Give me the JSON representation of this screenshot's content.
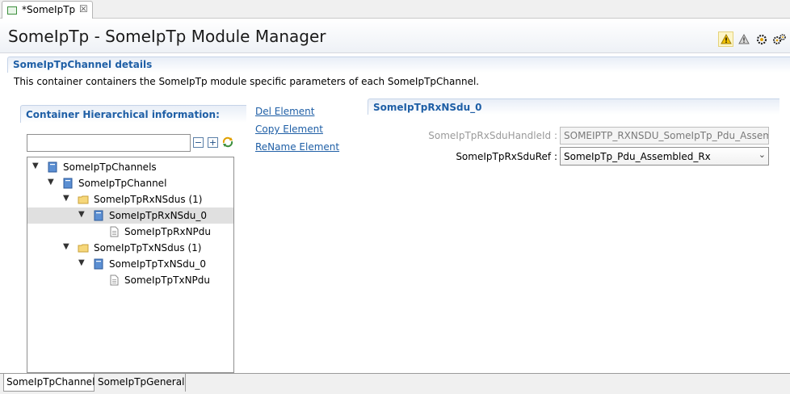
{
  "editor_tab": {
    "title": "*SomeIpTp",
    "close": "☒"
  },
  "header": {
    "title": "SomeIpTp - SomeIpTp Module Manager"
  },
  "section": {
    "title": "SomeIpTpChannel details",
    "description": "This container containers the SomeIpTp module specific parameters of each SomeIpTpChannel."
  },
  "hierarchy": {
    "title": "Container Hierarchical information:",
    "filter_value": "",
    "tree": [
      {
        "label": "SomeIpTpChannels",
        "twisty": "expanded",
        "icon": "container-icon"
      },
      {
        "label": "SomeIpTpChannel",
        "twisty": "expanded",
        "icon": "container-icon"
      },
      {
        "label": "SomeIpTpRxNSdus (1)",
        "twisty": "expanded",
        "icon": "folder-icon"
      },
      {
        "label": "SomeIpTpRxNSdu_0",
        "twisty": "expanded",
        "icon": "container-icon",
        "selected": true
      },
      {
        "label": "SomeIpTpRxNPdu",
        "twisty": "none",
        "icon": "document-icon"
      },
      {
        "label": "SomeIpTpTxNSdus (1)",
        "twisty": "expanded",
        "icon": "folder-icon"
      },
      {
        "label": "SomeIpTpTxNSdu_0",
        "twisty": "expanded",
        "icon": "container-icon"
      },
      {
        "label": "SomeIpTpTxNPdu",
        "twisty": "none",
        "icon": "document-icon"
      }
    ]
  },
  "actions": {
    "del": "Del Element",
    "copy": "Copy Element",
    "rename": "ReName Element"
  },
  "detail": {
    "title": "SomeIpTpRxNSdu_0",
    "handle_label": "SomeIpTpRxSduHandleId :",
    "handle_value": "SOMEIPTP_RXNSDU_SomeIpTp_Pdu_Assem",
    "ref_label": "SomeIpTpRxSduRef :",
    "ref_value": "SomeIpTp_Pdu_Assembled_Rx"
  },
  "bottom_tabs": {
    "channel": "SomeIpTpChannel",
    "general": "SomeIpTpGeneral"
  },
  "colors": {
    "accent": "#1f5fa6",
    "selection": "#e0e0e0",
    "warning": "#f2c200"
  }
}
